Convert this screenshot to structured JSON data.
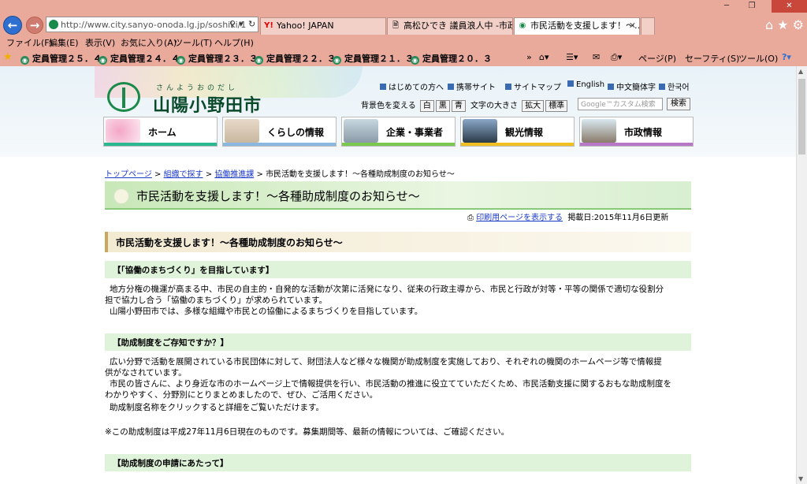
{
  "browser": {
    "address": "http://www.city.sanyo-onoda.lg.jp/soshiki/1",
    "tabs": [
      {
        "label": "Yahoo! JAPAN",
        "icon": "Y!"
      },
      {
        "label": "高松ひでき 議員浪人中 -市政…",
        "icon": "🗎"
      },
      {
        "label": "市民活動を支援します！～…",
        "icon": "◉"
      }
    ],
    "menus": [
      "ファイル(F)",
      "編集(E)",
      "表示(V)",
      "お気に入り(A)",
      "ツール(T)",
      "ヘルプ(H)"
    ],
    "favorites": [
      "定員管理２５．４",
      "定員管理２４．４",
      "定員管理２３．３",
      "定員管理２２．３",
      "定員管理２１．３",
      "定員管理２０．３"
    ],
    "commands": [
      "ページ(P)",
      "セーフティ(S)",
      "ツール(O)"
    ]
  },
  "site": {
    "logo_kana": "さんようおのだし",
    "logo_name": "山陽小野田市",
    "toplinks": [
      "はじめての方へ",
      "携帯サイト",
      "サイトマップ",
      "English",
      "中文簡体字",
      "한국어"
    ],
    "bg_label": "背景色を変える",
    "bg_options": [
      "白",
      "黒",
      "青"
    ],
    "font_label": "文字の大きさ",
    "font_options": [
      "拡大",
      "標準"
    ],
    "search_placeholder": "Google™カスタム検索",
    "search_button": "検索",
    "nav": [
      "ホーム",
      "くらしの情報",
      "企業・事業者",
      "観光情報",
      "市政情報"
    ]
  },
  "breadcrumb": {
    "links": [
      "トップページ",
      "組織で探す",
      "協働推進課"
    ],
    "current": "市民活動を支援します！～各種助成制度のお知らせ～"
  },
  "content": {
    "title": "市民活動を支援します！～各種助成制度のお知らせ～",
    "print_link": "印刷用ページを表示する",
    "posted": "掲載日:2015年11月6日更新",
    "section_title": "市民活動を支援します！～各種助成制度のお知らせ～",
    "h_collab": "【「協働のまちづくり」を目指しています】",
    "p_collab_1": "地方分権の機運が高まる中、市民の自主的・自発的な活動が次第に活発になり、従来の行政主導から、市民と行政が対等・平等の関係で適切な役割分",
    "p_collab_2": "担で協力し合う「協働のまちづくり」が求められています。",
    "p_collab_3": "山陽小野田市では、多様な組織や市民との協働によるまちづくりを目指しています。",
    "h_grant": "【助成制度をご存知ですか？】",
    "p_grant_1": "広い分野で活動を展開されている市民団体に対して、財団法人など様々な機関が助成制度を実施しており、それぞれの機関のホームページ等で情報提",
    "p_grant_2": "供がなされています。",
    "p_grant_3": "市民の皆さんに、より身近な市のホームページ上で情報提供を行い、市民活動の推進に役立てていただくため、市民活動支援に関するおもな助成制度を",
    "p_grant_4": "わかりやすく、分野別にとりまとめましたので、ぜひ、ご活用ください。",
    "p_grant_5": "助成制度名称をクリックすると詳細をご覧いただけます。",
    "note": "※この助成制度は平成27年11月6日現在のものです。募集期間等、最新の情報については、ご確認ください。",
    "h_apply": "【助成制度の申請にあたって】"
  },
  "colors": {
    "chrome": "#e9a99b",
    "accent_green": "#1a8a4a"
  }
}
